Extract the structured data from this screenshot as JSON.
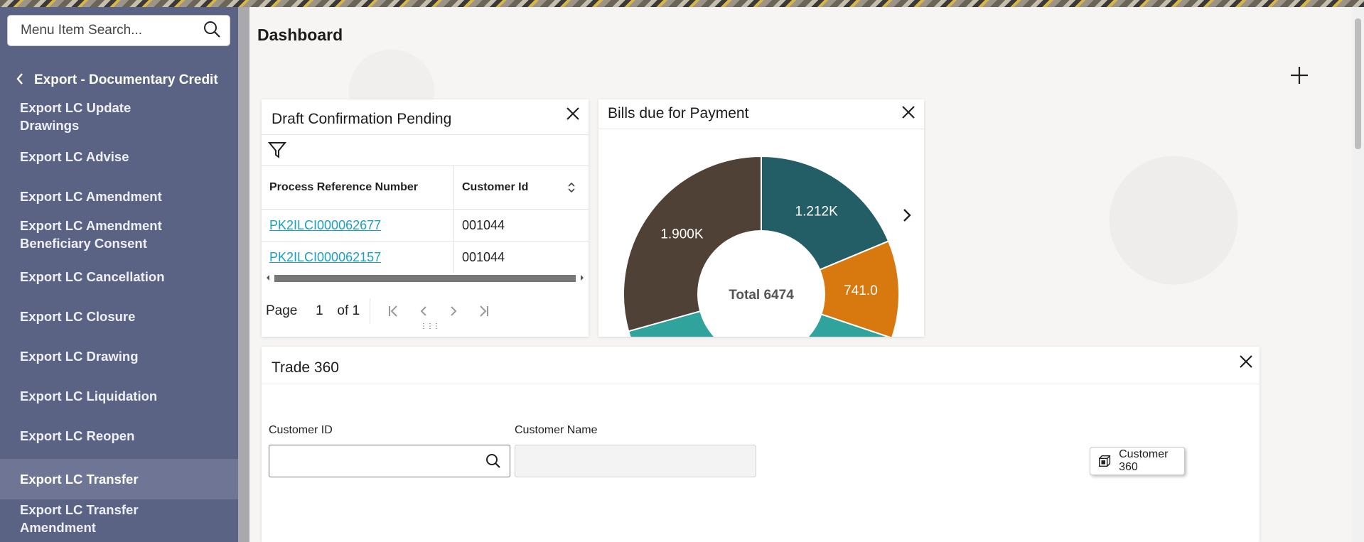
{
  "sidebar": {
    "search_placeholder": "Menu Item Search...",
    "back_label": "Export - Documentary Credit",
    "items": [
      {
        "label": "Export LC Update Drawings",
        "active": false
      },
      {
        "label": "Export LC Advise",
        "active": false
      },
      {
        "label": "Export LC Amendment",
        "active": false
      },
      {
        "label": "Export LC Amendment Beneficiary Consent",
        "active": false
      },
      {
        "label": "Export LC Cancellation",
        "active": false
      },
      {
        "label": "Export LC Closure",
        "active": false
      },
      {
        "label": "Export LC Drawing",
        "active": false
      },
      {
        "label": "Export LC Liquidation",
        "active": false
      },
      {
        "label": "Export LC Reopen",
        "active": false
      },
      {
        "label": "Export LC Transfer",
        "active": true
      },
      {
        "label": "Export LC Transfer Amendment",
        "active": false
      }
    ]
  },
  "page": {
    "title": "Dashboard"
  },
  "draft_card": {
    "title": "Draft Confirmation Pending",
    "columns": [
      "Process Reference Number",
      "Customer Id"
    ],
    "rows": [
      {
        "ref": "PK2ILCI000062677",
        "customer": "001044"
      },
      {
        "ref": "PK2ILCI000062157",
        "customer": "001044"
      }
    ],
    "pager": {
      "page_label": "Page",
      "page": "1",
      "of_label": "of 1"
    }
  },
  "bills_card": {
    "title": "Bills due for Payment",
    "center_label": "Total 6474",
    "chart_data": {
      "type": "pie",
      "total": 6474,
      "slices": [
        {
          "label": "1.212K",
          "value": 1212,
          "color": "#235e66"
        },
        {
          "label": "741.0",
          "value": 741,
          "color": "#d7790f"
        },
        {
          "label": "",
          "value": 1310,
          "color": "#2fa39c"
        },
        {
          "label": "",
          "value": 1311,
          "color": "#2fa39c"
        },
        {
          "label": "1.900K",
          "value": 1900,
          "color": "#4f4136"
        }
      ]
    }
  },
  "trade_card": {
    "title": "Trade 360",
    "customer_id_label": "Customer ID",
    "customer_id_value": "",
    "customer_name_label": "Customer Name",
    "customer_name_value": "",
    "customer360_label": "Customer 360"
  },
  "colors": {
    "sidebar": "#5b6384",
    "sidebar_active": "#6f7695",
    "link": "#1aa0c4"
  }
}
